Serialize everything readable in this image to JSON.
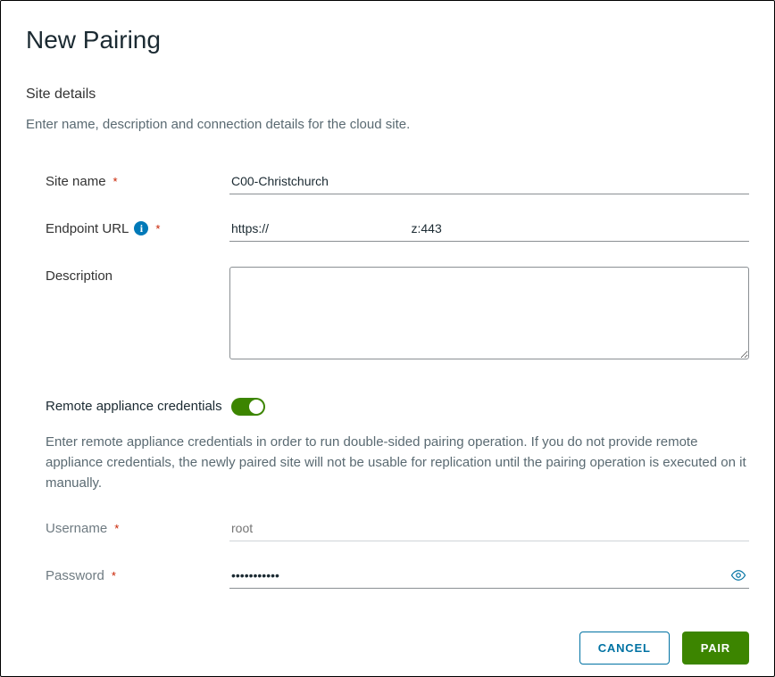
{
  "dialog": {
    "title": "New Pairing"
  },
  "siteDetails": {
    "heading": "Site details",
    "helper": "Enter name, description and connection details for the cloud site.",
    "siteName": {
      "label": "Site name",
      "value": "C00-Christchurch"
    },
    "endpoint": {
      "label": "Endpoint URL",
      "value": "https://                                         z:443"
    },
    "description": {
      "label": "Description",
      "value": ""
    }
  },
  "credentials": {
    "toggleLabel": "Remote appliance credentials",
    "toggleOn": true,
    "helper": "Enter remote appliance credentials in order to run double-sided pairing operation. If you do not provide remote appliance credentials, the newly paired site will not be usable for replication until the pairing operation is executed on it manually.",
    "username": {
      "label": "Username",
      "placeholder": "root",
      "value": ""
    },
    "password": {
      "label": "Password",
      "value": "•••••••••••"
    }
  },
  "footer": {
    "cancel": "CANCEL",
    "pair": "PAIR"
  }
}
